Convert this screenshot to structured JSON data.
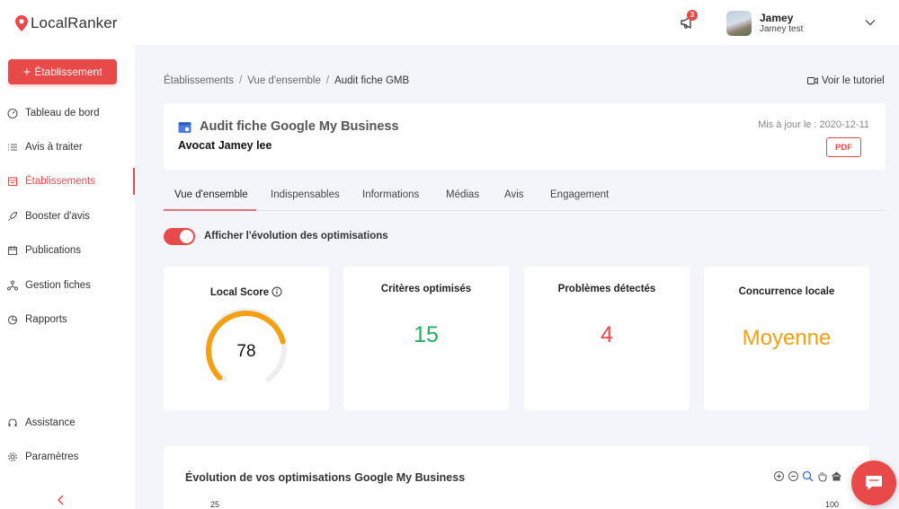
{
  "brand": {
    "name_part1": "Local",
    "name_part2": "Ranker",
    "accent": "#e84a4a"
  },
  "topbar": {
    "notifications_count": "3",
    "user_name": "Jamey",
    "user_org": "Jamey test"
  },
  "sidebar": {
    "add_button": "Établissement",
    "items": [
      {
        "label": "Tableau de bord",
        "icon": "dashboard-icon"
      },
      {
        "label": "Avis à traiter",
        "icon": "list-icon"
      },
      {
        "label": "Établissements",
        "icon": "store-icon",
        "active": true
      },
      {
        "label": "Booster d'avis",
        "icon": "rocket-icon"
      },
      {
        "label": "Publications",
        "icon": "calendar-icon"
      },
      {
        "label": "Gestion fiches",
        "icon": "network-icon"
      },
      {
        "label": "Rapports",
        "icon": "pie-chart-icon"
      }
    ],
    "bottom_items": [
      {
        "label": "Assistance",
        "icon": "headset-icon"
      },
      {
        "label": "Paramètres",
        "icon": "gear-icon"
      }
    ]
  },
  "breadcrumb": [
    "Établissements",
    "Vue d'ensemble",
    "Audit fiche GMB"
  ],
  "tutorial_label": "Voir le tutoriel",
  "header": {
    "title": "Audit fiche Google My Business",
    "subtitle": "Avocat Jamey lee",
    "updated": "Mis à jour le : 2020-12-11",
    "pdf_label": "PDF"
  },
  "tabs": [
    "Vue d'ensemble",
    "Indispensables",
    "Informations",
    "Médias",
    "Avis",
    "Engagement"
  ],
  "active_tab": "Vue d'ensemble",
  "toggle": {
    "label": "Afficher l'évolution des optimisations",
    "on": true
  },
  "stats": {
    "local_score": {
      "label": "Local Score",
      "value": "78",
      "fraction": 0.78,
      "color": "#f5a012"
    },
    "criteres": {
      "label": "Critères optimisés",
      "value": "15",
      "color": "#27ae60"
    },
    "problemes": {
      "label": "Problèmes détectés",
      "value": "4",
      "color": "#e84a4a"
    },
    "concurrence": {
      "label": "Concurrence locale",
      "value": "Moyenne",
      "color": "#f5a012"
    }
  },
  "evolution": {
    "title": "Évolution de vos optimisations Google My Business",
    "y_left_top": "25",
    "y_right_top": "100"
  }
}
